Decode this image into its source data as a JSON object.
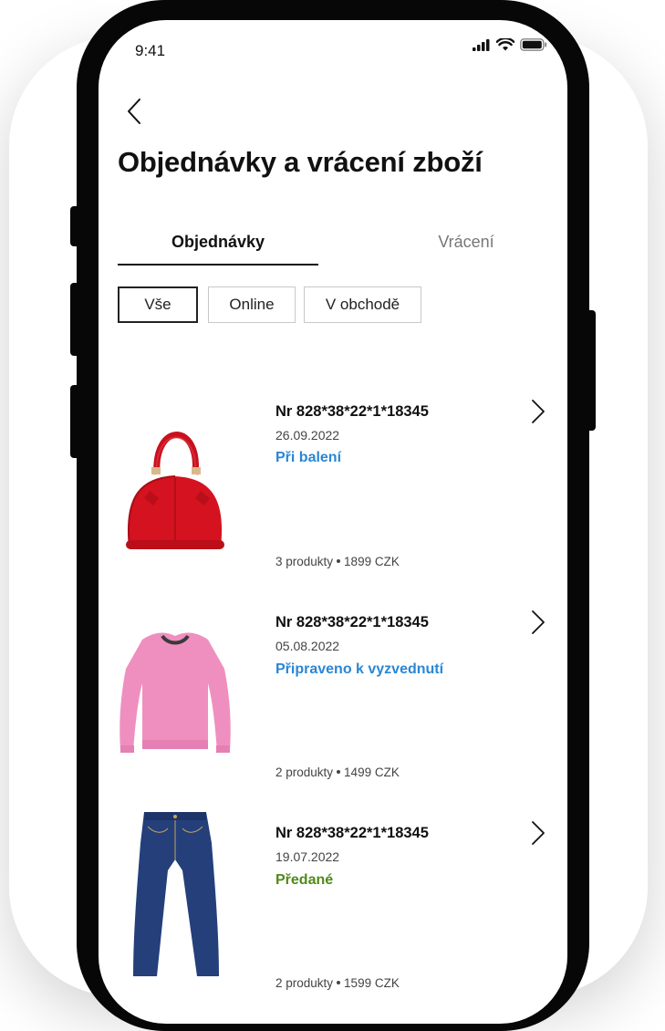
{
  "status_bar": {
    "time": "9:41"
  },
  "page": {
    "title": "Objednávky a vrácení zboží"
  },
  "tabs": [
    {
      "label": "Objednávky",
      "active": true
    },
    {
      "label": "Vrácení",
      "active": false
    }
  ],
  "filters": [
    {
      "label": "Vše",
      "selected": true
    },
    {
      "label": "Online",
      "selected": false
    },
    {
      "label": "V obchodě",
      "selected": false
    }
  ],
  "orders": [
    {
      "number": "Nr 828*38*22*1*18345",
      "date": "26.09.2022",
      "status": "Při balení",
      "status_color": "#2a86d4",
      "products": "3 produkty",
      "price": "1899 CZK",
      "image": "red-handbag"
    },
    {
      "number": "Nr 828*38*22*1*18345",
      "date": "05.08.2022",
      "status": "Připraveno k vyzvednutí",
      "status_color": "#2a86d4",
      "products": "2 produkty",
      "price": "1499 CZK",
      "image": "pink-sweater"
    },
    {
      "number": "Nr 828*38*22*1*18345",
      "date": "19.07.2022",
      "status": "Předané",
      "status_color": "#4f8a1a",
      "products": "2 produkty",
      "price": "1599 CZK",
      "image": "blue-jeans"
    }
  ]
}
